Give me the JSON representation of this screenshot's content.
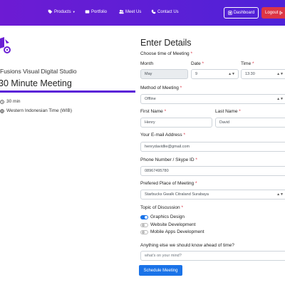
{
  "nav": {
    "products": "Products",
    "portfolio": "Portfolio",
    "meet_us": "Meet Us",
    "contact_us": "Contact Us",
    "dashboard": "Dashboard",
    "logout": "Logout"
  },
  "event": {
    "studio_name": "Fusions Visual Digital Studio",
    "title": "30 Minute Meeting",
    "duration": "30 min",
    "timezone": "Western Indonesian Time (WIB)"
  },
  "form": {
    "title": "Enter Details",
    "time_label": "Choose time of Meeting",
    "month_label": "Month",
    "month_value": "May",
    "date_label": "Date",
    "date_value": "9",
    "time_sub_label": "Time",
    "time_value": "13:30",
    "method_label": "Method of Meeting",
    "method_value": "Offline",
    "first_name_label": "First Name",
    "first_name_value": "Henry",
    "last_name_label": "Last Name",
    "last_name_value": "David",
    "email_label": "Your E-mail Address",
    "email_value": "henrydavidlie@gmail.com",
    "phone_label": "Phone Number / Skype ID",
    "phone_value": "08967495780",
    "place_label": "Prefered Place of Meeting",
    "place_value": "Starbucks Gwalk Citraland Surabaya",
    "topic_label": "Topic of Discussion",
    "topics": [
      {
        "label": "Graphics Design",
        "checked": true
      },
      {
        "label": "Website Development",
        "checked": false
      },
      {
        "label": "Mobile Apps Development",
        "checked": false
      }
    ],
    "extra_label": "Anything else we should know ahead of time?",
    "extra_placeholder": "what's on your mind?",
    "submit_label": "Schedule Meeting",
    "required_mark": "*"
  },
  "colors": {
    "nav_start": "#6d1bd3",
    "nav_end": "#4e22d8",
    "accent": "#5a1fd8",
    "primary": "#1a73e8",
    "danger": "#dc3545"
  }
}
